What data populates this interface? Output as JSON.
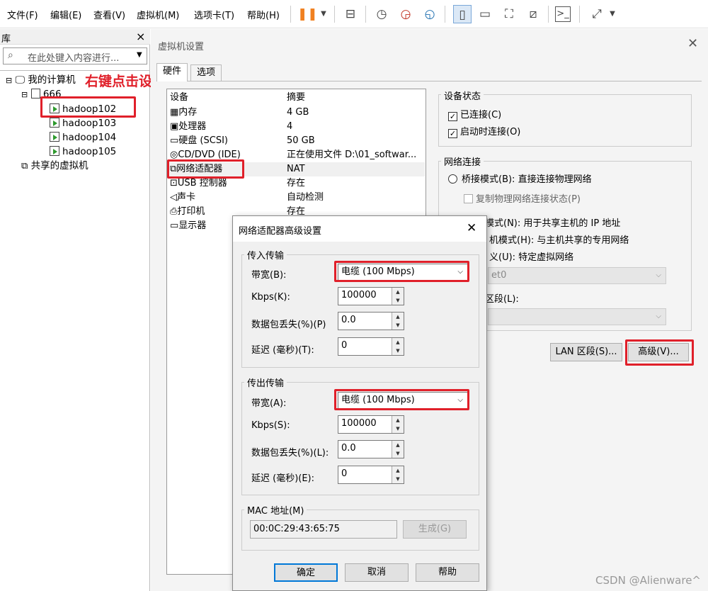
{
  "menubar": {
    "items": [
      "文件(F)",
      "编辑(E)",
      "查看(V)",
      "虚拟机(M)",
      "选项卡(T)",
      "帮助(H)"
    ]
  },
  "library": {
    "title": "库",
    "close": "×",
    "search_placeholder": "在此处键入内容进行...",
    "my_computer": "我的计算机",
    "folder": "666",
    "vms": [
      "hadoop102",
      "hadoop103",
      "hadoop104",
      "hadoop105"
    ],
    "shared": "共享的虚拟机"
  },
  "annotation": "右键点击设置",
  "settings": {
    "title": "虚拟机设置",
    "tabs": [
      "硬件",
      "选项"
    ],
    "col_device": "设备",
    "col_summary": "摘要",
    "devices": [
      {
        "name": "内存",
        "summary": "4 GB"
      },
      {
        "name": "处理器",
        "summary": "4"
      },
      {
        "name": "硬盘 (SCSI)",
        "summary": "50 GB"
      },
      {
        "name": "CD/DVD (IDE)",
        "summary": "正在使用文件 D:\\01_softwar..."
      },
      {
        "name": "网络适配器",
        "summary": "NAT"
      },
      {
        "name": "USB 控制器",
        "summary": "存在"
      },
      {
        "name": "声卡",
        "summary": "自动检测"
      },
      {
        "name": "打印机",
        "summary": "存在"
      },
      {
        "name": "显示器",
        "summary": ""
      }
    ],
    "device_status": "设备状态",
    "connected": "已连接(C)",
    "connect_on_start": "启动时连接(O)",
    "network_connection": "网络连接",
    "bridged": "桥接模式(B): 直接连接物理网络",
    "replicate": "复制物理网络连接状态(P)",
    "nat_partial": "模式(N): 用于共享主机的 IP 地址",
    "hostonly_partial": "机模式(H): 与主机共享的专用网络",
    "custom_partial": "义(U): 特定虚拟网络",
    "vmnet_partial": "et0",
    "lan_partial": "区段(L):",
    "lan_segments_btn": "LAN 区段(S)...",
    "advanced_btn": "高级(V)..."
  },
  "dialog": {
    "title": "网络适配器高级设置",
    "incoming": "传入传输",
    "outgoing": "传出传输",
    "bandwidth_in_label": "带宽(B):",
    "bandwidth_out_label": "带宽(A):",
    "bandwidth_value": "电缆 (100 Mbps)",
    "kbps_in_label": "Kbps(K):",
    "kbps_out_label": "Kbps(S):",
    "kbps_value": "100000",
    "loss_in_label": "数据包丢失(%)(P)",
    "loss_out_label": "数据包丢失(%)(L):",
    "loss_value": "0.0",
    "latency_in_label": "延迟 (毫秒)(T):",
    "latency_out_label": "延迟 (毫秒)(E):",
    "latency_value": "0",
    "mac_title": "MAC 地址(M)",
    "mac_value": "00:0C:29:43:65:75",
    "generate_btn": "生成(G)",
    "ok": "确定",
    "cancel": "取消",
    "help": "帮助"
  },
  "watermark": "CSDN @Alienware^"
}
